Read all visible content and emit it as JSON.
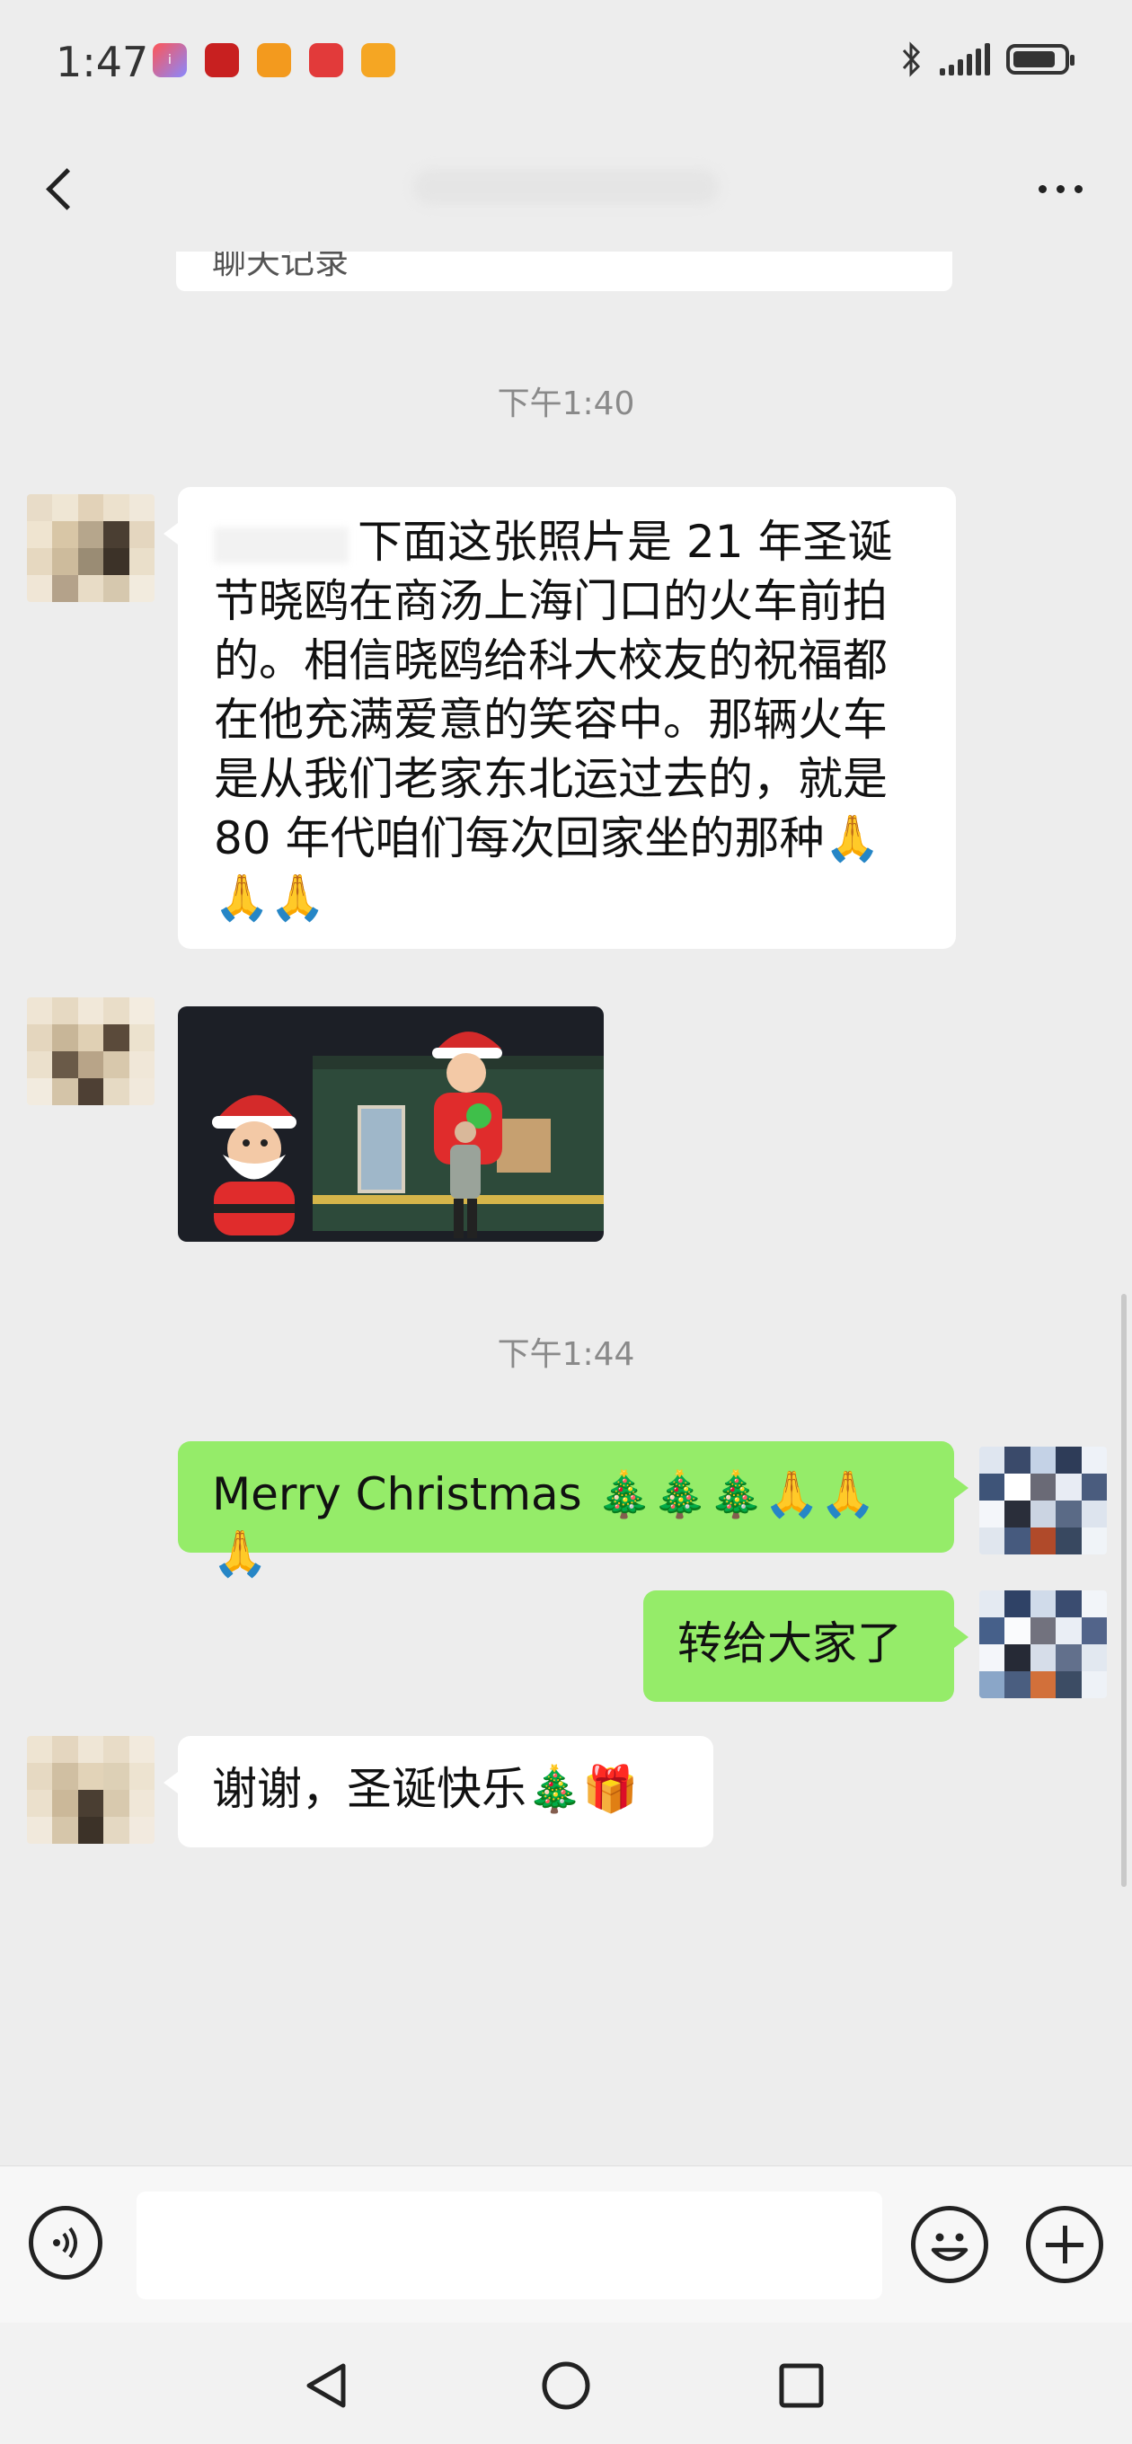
{
  "status_bar": {
    "time": "1:47",
    "app_icons": [
      "app-icon",
      "app-icon",
      "app-icon",
      "app-icon",
      "app-icon"
    ],
    "bluetooth_icon": "bluetooth-icon",
    "signal_icon": "signal-icon",
    "battery_level": 0.85
  },
  "nav": {
    "back_icon": "chevron-left-icon",
    "more_icon": "more-dots-icon"
  },
  "chat": {
    "prev_card_text": "聊天记录",
    "timestamp_1": "下午1:40",
    "message_1": "下面这张照片是 21 年圣诞节晓鸥在商汤上海门口的火车前拍的。相信晓鸥给科大校友的祝福都在他充满爱意的笑容中。那辆火车是从我们老家东北运过去的，就是 80 年代咱们每次回家坐的那种🙏🙏🙏",
    "timestamp_2": "下午1:44",
    "message_3": "Merry Christmas 🎄🎄🎄🙏🙏🙏",
    "message_4": "转给大家了",
    "message_5": "谢谢，圣诞快乐🎄🎁"
  },
  "colors": {
    "background": "#ededed",
    "incoming_bubble": "#ffffff",
    "outgoing_bubble": "#95ec69"
  },
  "input_bar": {
    "voice_icon": "voice-icon",
    "text_value": "",
    "emoji_icon": "emoji-icon",
    "add_icon": "plus-icon"
  },
  "system_nav": {
    "back_icon": "triangle-back-icon",
    "home_icon": "circle-home-icon",
    "recents_icon": "square-recents-icon"
  }
}
